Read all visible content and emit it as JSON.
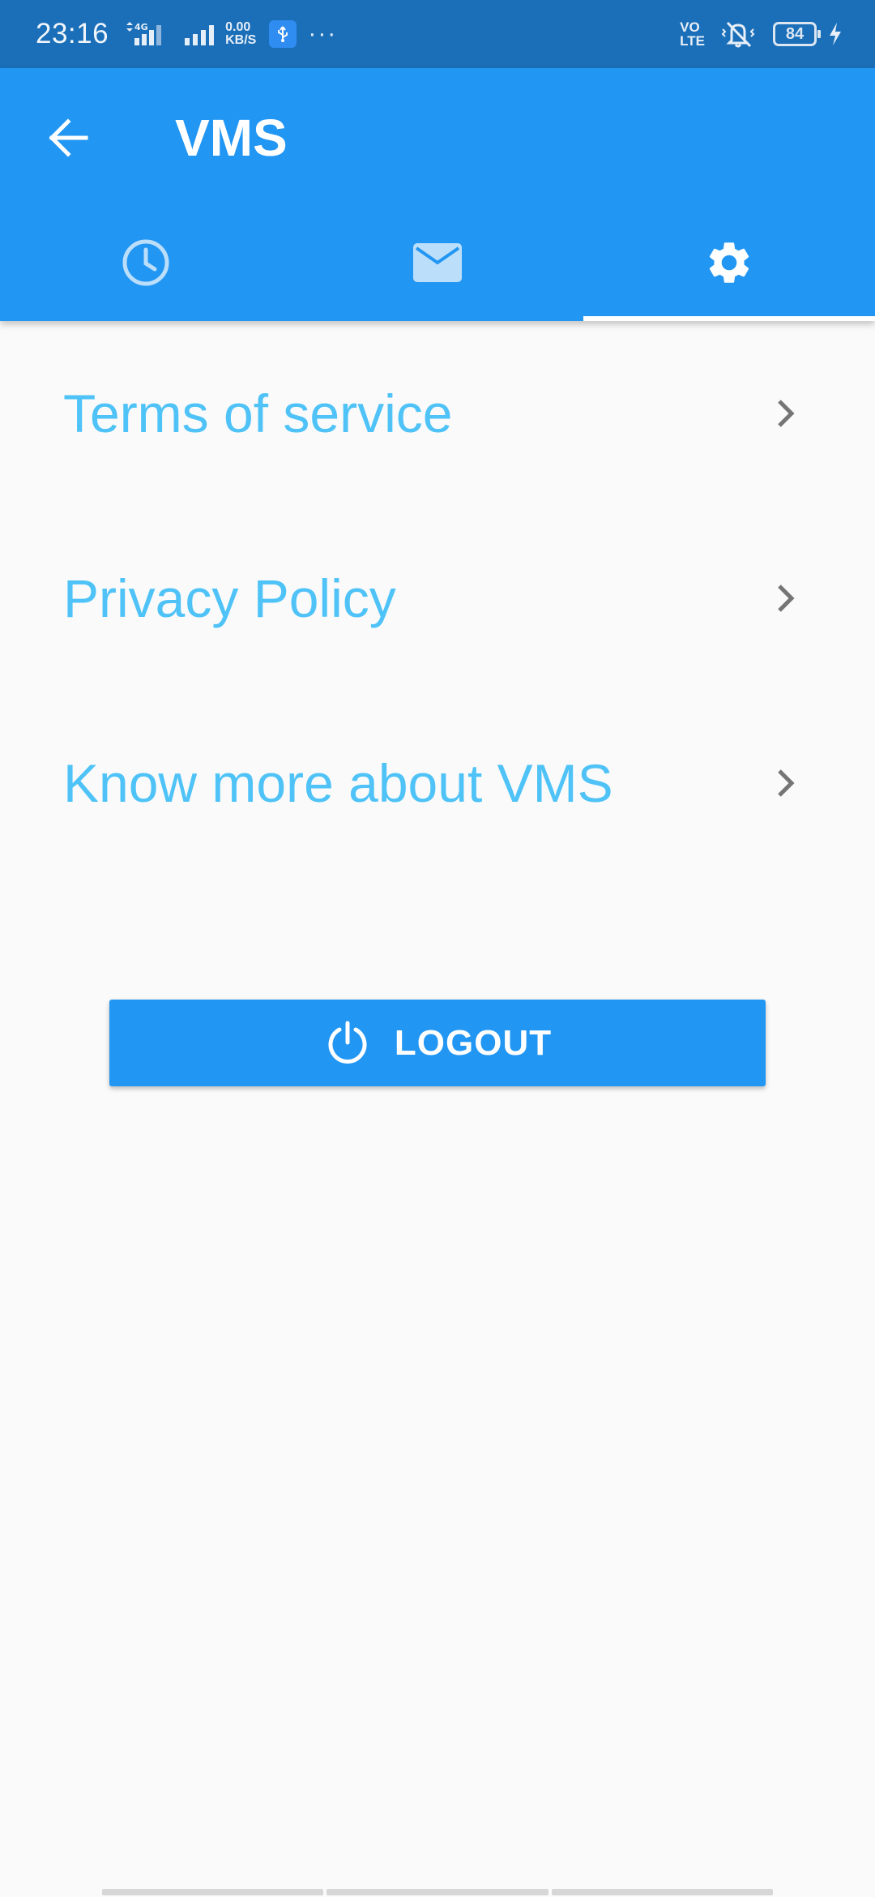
{
  "status_bar": {
    "time": "23:16",
    "network_type": "4G",
    "net_speed_value": "0.00",
    "net_speed_unit": "KB/S",
    "volte_top": "VO",
    "volte_bottom": "LTE",
    "battery_level": "84"
  },
  "app_bar": {
    "title": "VMS",
    "tabs": [
      {
        "icon": "clock-icon",
        "active": false
      },
      {
        "icon": "mail-icon",
        "active": false
      },
      {
        "icon": "gear-icon",
        "active": true
      }
    ]
  },
  "settings": {
    "items": [
      {
        "label": "Terms of service"
      },
      {
        "label": "Privacy Policy"
      },
      {
        "label": "Know more about VMS"
      }
    ]
  },
  "logout": {
    "label": "LOGOUT"
  },
  "colors": {
    "primary": "#2196f3",
    "status_bar": "#1b6fb8",
    "link_text": "#4fc3f7",
    "background": "#fafafa"
  }
}
